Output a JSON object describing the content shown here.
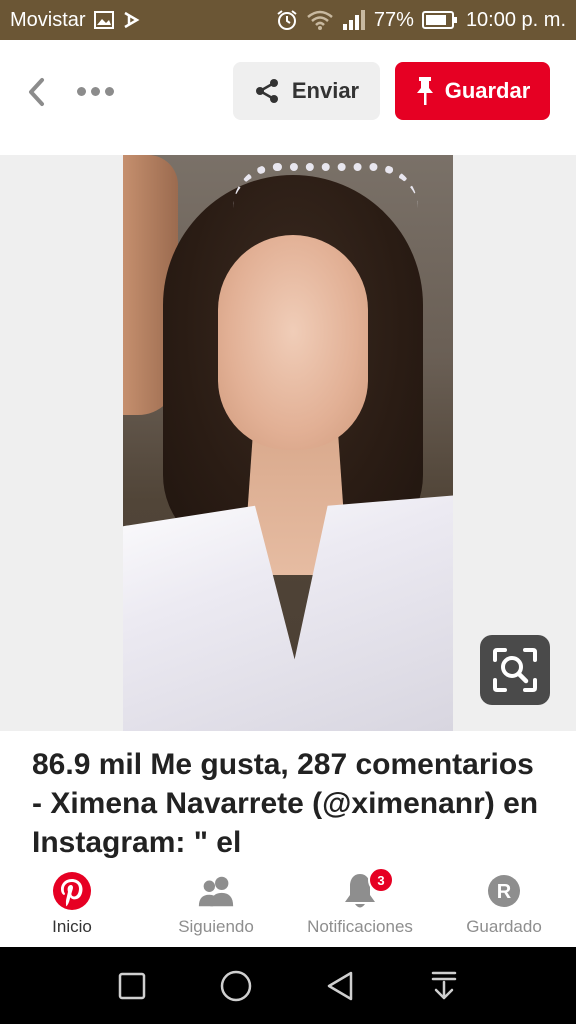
{
  "status_bar": {
    "carrier": "Movistar",
    "battery": "77%",
    "time": "10:00 p. m."
  },
  "toolbar": {
    "send_label": "Enviar",
    "save_label": "Guardar"
  },
  "pin": {
    "description": "86.9 mil Me gusta, 287 comentarios - Ximena Navarrete (@ximenanr) en Instagram: \" el"
  },
  "tabs": [
    {
      "label": "Inicio",
      "icon": "pinterest-logo-icon",
      "active": true
    },
    {
      "label": "Siguiendo",
      "icon": "people-icon",
      "active": false
    },
    {
      "label": "Notificaciones",
      "icon": "bell-icon",
      "active": false,
      "badge": "3"
    },
    {
      "label": "Guardado",
      "icon": "profile-r-icon",
      "active": false
    }
  ],
  "colors": {
    "brand": "#e60023",
    "status_bar": "#6b5635",
    "navbar": "#000000"
  }
}
